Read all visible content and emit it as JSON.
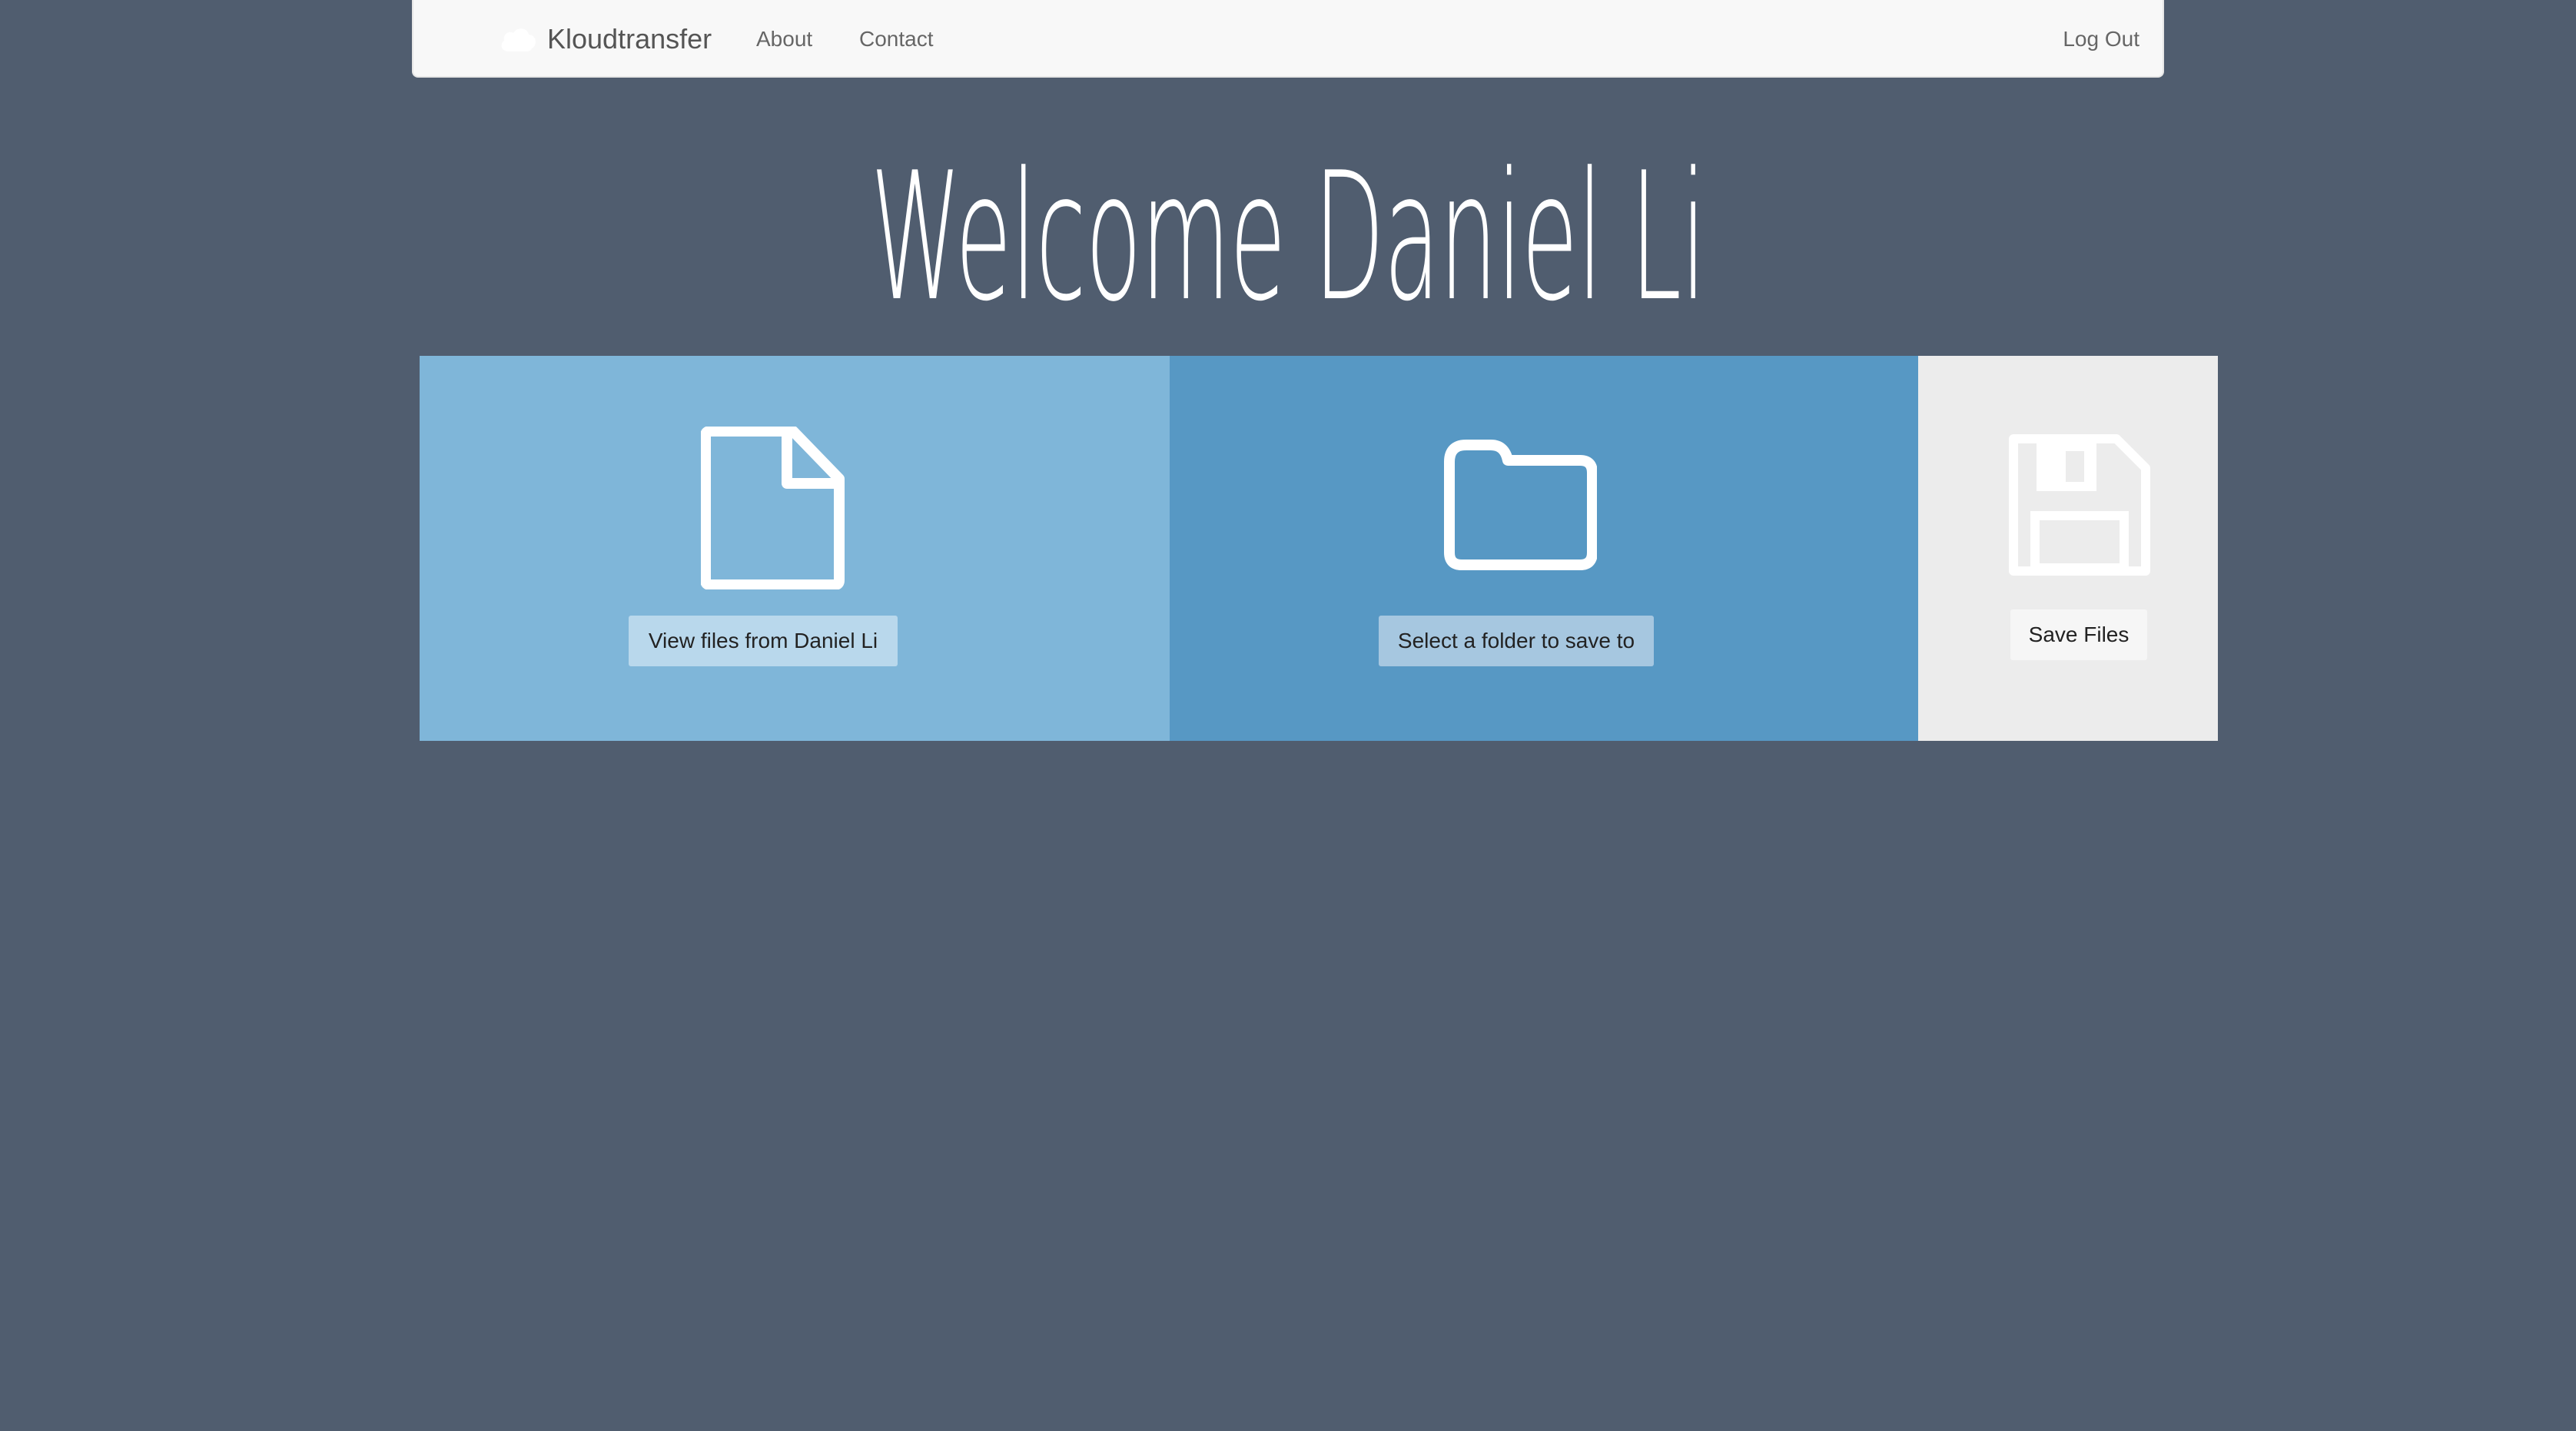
{
  "navbar": {
    "brand": "Kloudtransfer",
    "links": [
      {
        "label": "About"
      },
      {
        "label": "Contact"
      }
    ],
    "logout": "Log Out"
  },
  "welcome": {
    "title": "Welcome Daniel Li"
  },
  "panels": {
    "view": {
      "icon": "file-icon",
      "button": "View files from Daniel Li",
      "color": "#7fb6d9"
    },
    "folder": {
      "icon": "folder-icon",
      "button": "Select a folder to save to",
      "color": "#5798c4"
    },
    "save": {
      "icon": "floppy-disk-icon",
      "button": "Save Files",
      "color": "#ececec"
    }
  },
  "colors": {
    "background": "#505d6f",
    "navbar": "#f8f8f8"
  }
}
